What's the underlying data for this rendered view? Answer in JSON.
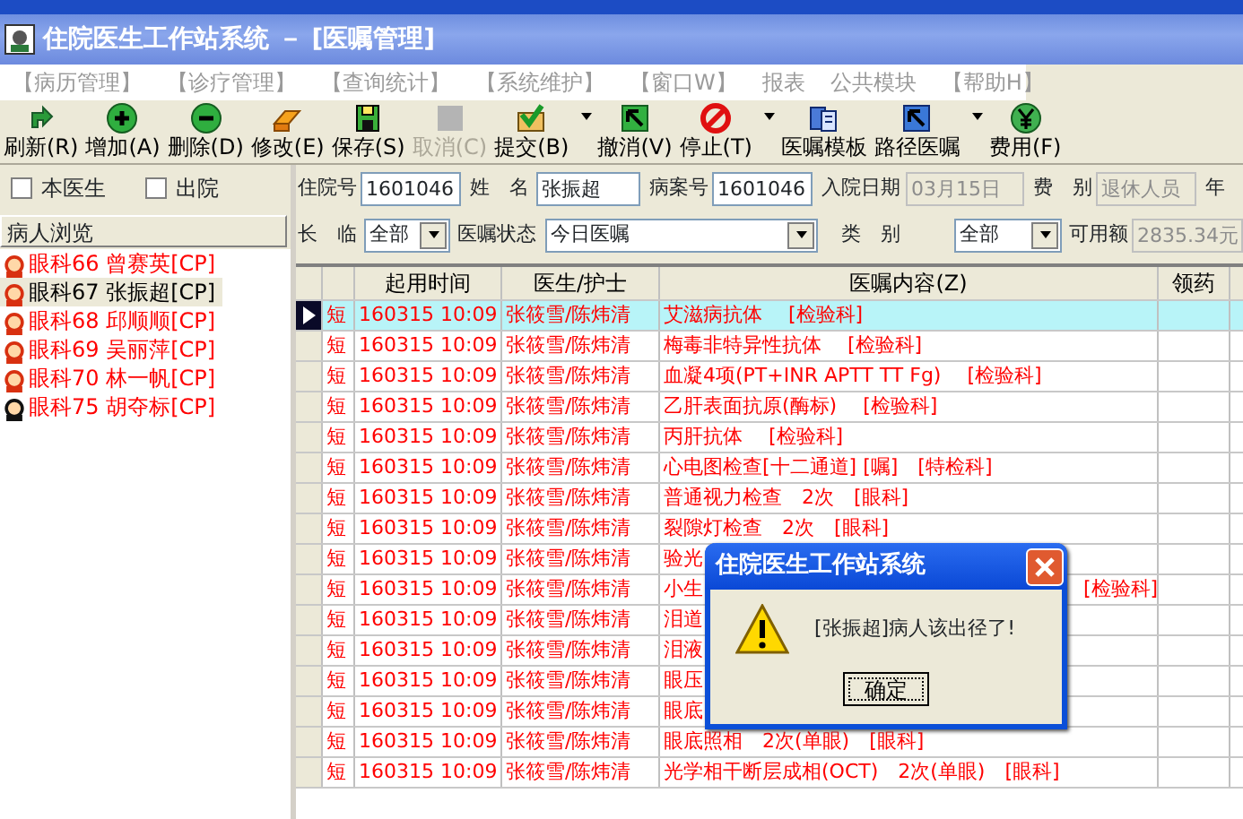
{
  "window": {
    "title": "住院医生工作站系统 － [医嘱管理]"
  },
  "menu": [
    "【病历管理】",
    "【诊疗管理】",
    "【查询统计】",
    "【系统维护】",
    "【窗口W】",
    "报表",
    "公共模块",
    "【帮助H】"
  ],
  "toolbar": [
    {
      "label": "刷新(R)",
      "dropdown": false,
      "disabled": false
    },
    {
      "label": "增加(A)",
      "dropdown": false,
      "disabled": false
    },
    {
      "label": "删除(D)",
      "dropdown": false,
      "disabled": false
    },
    {
      "label": "修改(E)",
      "dropdown": false,
      "disabled": false
    },
    {
      "label": "保存(S)",
      "dropdown": false,
      "disabled": false
    },
    {
      "label": "取消(C)",
      "dropdown": false,
      "disabled": true
    },
    {
      "label": "提交(B)",
      "dropdown": true,
      "disabled": false
    },
    {
      "label": "撤消(V)",
      "dropdown": false,
      "disabled": false
    },
    {
      "label": "停止(T)",
      "dropdown": true,
      "disabled": false
    },
    {
      "label": "医嘱模板",
      "dropdown": false,
      "disabled": false
    },
    {
      "label": "路径医嘱",
      "dropdown": true,
      "disabled": false
    },
    {
      "label": "费用(F)",
      "dropdown": false,
      "disabled": false
    }
  ],
  "filters": [
    {
      "label": "本医生",
      "checked": false
    },
    {
      "label": "出院",
      "checked": false
    }
  ],
  "patients": {
    "header": "病人浏览",
    "items": [
      {
        "label": "眼科66  曾赛英[CP]",
        "kind": "female",
        "selected": false
      },
      {
        "label": "眼科67  张振超[CP]",
        "kind": "female",
        "selected": true
      },
      {
        "label": "眼科68  邱顺顺[CP]",
        "kind": "female",
        "selected": false
      },
      {
        "label": "眼科69  吴丽萍[CP]",
        "kind": "female",
        "selected": false
      },
      {
        "label": "眼科70  林一帆[CP]",
        "kind": "female",
        "selected": false
      },
      {
        "label": "眼科75  胡夺标[CP]",
        "kind": "male",
        "selected": false
      }
    ]
  },
  "form": {
    "row_1": [
      {
        "label": "住院号",
        "value": "1601046",
        "disabled": false
      },
      {
        "label": "姓　名",
        "value": "张振超",
        "disabled": false
      },
      {
        "label": "病案号",
        "value": "1601046",
        "disabled": false
      },
      {
        "label": "入院日期",
        "value": "03月15日",
        "disabled": true
      },
      {
        "label": "费　别",
        "value": "退休人员",
        "disabled": true
      },
      {
        "label": "年"
      }
    ],
    "row_2": [
      {
        "label": "长　临",
        "kind": "select",
        "value": "全部"
      },
      {
        "label": "医嘱状态",
        "kind": "select",
        "value": "今日医嘱"
      },
      {
        "label": "类　别",
        "kind": "select",
        "value": "全部"
      },
      {
        "label": "可用额",
        "kind": "readonly",
        "value": "2835.34元"
      }
    ]
  },
  "table": {
    "columns": [
      "起用时间",
      "医生/护士",
      "医嘱内容(Z)",
      "领药"
    ],
    "rows": [
      {
        "type": "短",
        "time": "160315 10:09",
        "staff": "张筱雪/陈炜清",
        "content": "艾滋病抗体　 [检验科]",
        "selected": true
      },
      {
        "type": "短",
        "time": "160315 10:09",
        "staff": "张筱雪/陈炜清",
        "content": "梅毒非特异性抗体　 [检验科]",
        "selected": false
      },
      {
        "type": "短",
        "time": "160315 10:09",
        "staff": "张筱雪/陈炜清",
        "content": "血凝4项(PT+INR APTT TT Fg)　 [检验科]",
        "selected": false
      },
      {
        "type": "短",
        "time": "160315 10:09",
        "staff": "张筱雪/陈炜清",
        "content": "乙肝表面抗原(酶标)　 [检验科]",
        "selected": false
      },
      {
        "type": "短",
        "time": "160315 10:09",
        "staff": "张筱雪/陈炜清",
        "content": "丙肝抗体　 [检验科]",
        "selected": false
      },
      {
        "type": "短",
        "time": "160315 10:09",
        "staff": "张筱雪/陈炜清",
        "content": "心电图检查[十二通道] [嘱]　[特检科]",
        "selected": false
      },
      {
        "type": "短",
        "time": "160315 10:09",
        "staff": "张筱雪/陈炜清",
        "content": "普通视力检查　2次　[眼科]",
        "selected": false
      },
      {
        "type": "短",
        "time": "160315 10:09",
        "staff": "张筱雪/陈炜清",
        "content": "裂隙灯检查　2次　[眼科]",
        "selected": false
      },
      {
        "type": "短",
        "time": "160315 10:09",
        "staff": "张筱雪/陈炜清",
        "content": "验光",
        "selected": false
      },
      {
        "type": "短",
        "time": "160315 10:09",
        "staff": "张筱雪/陈炜清",
        "content": "小生",
        "tail": "[检验科]",
        "selected": false
      },
      {
        "type": "短",
        "time": "160315 10:09",
        "staff": "张筱雪/陈炜清",
        "content": "泪道",
        "selected": false
      },
      {
        "type": "短",
        "time": "160315 10:09",
        "staff": "张筱雪/陈炜清",
        "content": "泪液",
        "selected": false
      },
      {
        "type": "短",
        "time": "160315 10:09",
        "staff": "张筱雪/陈炜清",
        "content": "眼压",
        "selected": false
      },
      {
        "type": "短",
        "time": "160315 10:09",
        "staff": "张筱雪/陈炜清",
        "content": "眼底",
        "selected": false
      },
      {
        "type": "短",
        "time": "160315 10:09",
        "staff": "张筱雪/陈炜清",
        "content": "眼底照相　2次(单眼)　[眼科]",
        "selected": false
      },
      {
        "type": "短",
        "time": "160315 10:09",
        "staff": "张筱雪/陈炜清",
        "content": "光学相干断层成相(OCT)　2次(单眼)　[眼科]",
        "selected": false
      }
    ]
  },
  "dialog": {
    "title": "住院医生工作站系统",
    "message": "[张振超]病人该出径了!",
    "button": "确定"
  }
}
